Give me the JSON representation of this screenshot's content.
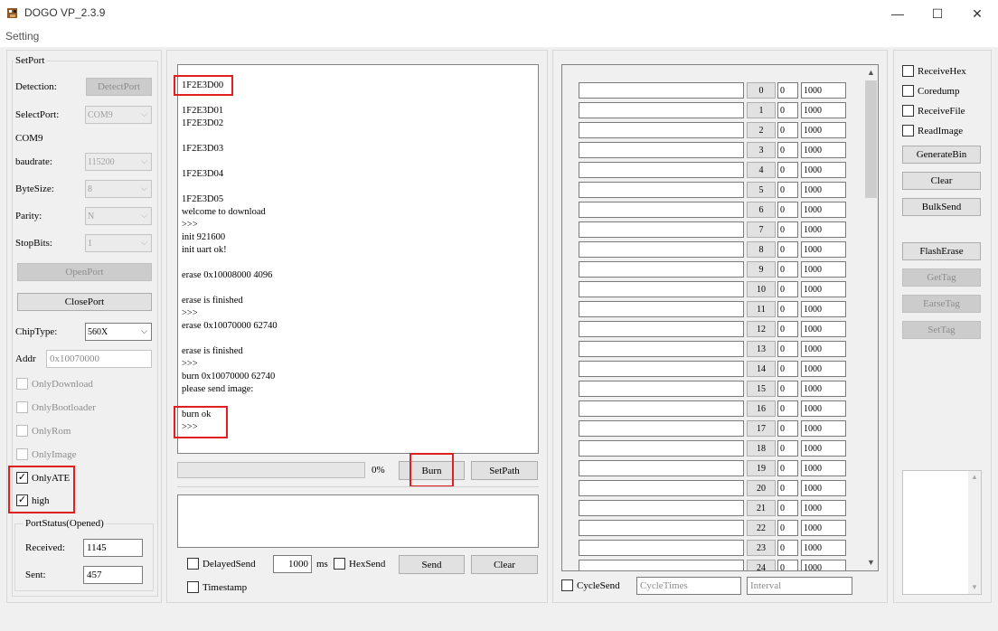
{
  "window": {
    "title": "DOGO  VP_2.3.9",
    "minimize_glyph": "—",
    "maximize_glyph": "☐",
    "close_glyph": "✕"
  },
  "menu": {
    "setting": "Setting"
  },
  "setport": {
    "title": "SetPort",
    "detection_label": "Detection:",
    "detect_button": "DetectPort",
    "selectport_label": "SelectPort:",
    "selectport_value": "COM9",
    "com_text": "COM9",
    "baudrate_label": "baudrate:",
    "baudrate_value": "115200",
    "bytesize_label": "ByteSize:",
    "bytesize_value": "8",
    "parity_label": "Parity:",
    "parity_value": "N",
    "stopbits_label": "StopBits:",
    "stopbits_value": "1",
    "openport_button": "OpenPort",
    "closeport_button": "ClosePort",
    "chiptype_label": "ChipType:",
    "chiptype_value": "560X",
    "addr_label": "Addr",
    "addr_value": "0x10070000",
    "only_download": "OnlyDownload",
    "only_bootloader": "OnlyBootloader",
    "only_rom": "OnlyRom",
    "only_image": "OnlyImage",
    "only_ate": "OnlyATE",
    "high": "high",
    "check_glyph": "✓"
  },
  "portstatus": {
    "title": "PortStatus(Opened)",
    "received_label": "Received:",
    "received_value": "1145",
    "sent_label": "Sent:",
    "sent_value": "457"
  },
  "log": {
    "lines": [
      "1F2E3D00",
      "1F2E3D01",
      "1F2E3D02",
      "1F2E3D03",
      "1F2E3D04",
      "1F2E3D05",
      "welcome to download",
      ">>>",
      "init 921600",
      "init uart ok!",
      "erase 0x10008000 4096",
      "erase is finished",
      ">>>",
      "erase 0x10070000 62740",
      "erase is finished",
      ">>>",
      "burn 0x10070000 62740",
      "please send image:",
      "burn ok",
      ">>>"
    ]
  },
  "burn": {
    "progress_text": "0%",
    "progress_value": 0,
    "burn_button": "Burn",
    "setpath_button": "SetPath"
  },
  "send": {
    "delayed_send": "DelayedSend",
    "delay_value": "1000",
    "ms_label": "ms",
    "hexsend": "HexSend",
    "send_button": "Send",
    "clear_button": "Clear",
    "timestamp": "Timestamp"
  },
  "multisend": {
    "rows": [
      {
        "num": "0",
        "a": "0",
        "b": "1000"
      },
      {
        "num": "1",
        "a": "0",
        "b": "1000"
      },
      {
        "num": "2",
        "a": "0",
        "b": "1000"
      },
      {
        "num": "3",
        "a": "0",
        "b": "1000"
      },
      {
        "num": "4",
        "a": "0",
        "b": "1000"
      },
      {
        "num": "5",
        "a": "0",
        "b": "1000"
      },
      {
        "num": "6",
        "a": "0",
        "b": "1000"
      },
      {
        "num": "7",
        "a": "0",
        "b": "1000"
      },
      {
        "num": "8",
        "a": "0",
        "b": "1000"
      },
      {
        "num": "9",
        "a": "0",
        "b": "1000"
      },
      {
        "num": "10",
        "a": "0",
        "b": "1000"
      },
      {
        "num": "11",
        "a": "0",
        "b": "1000"
      },
      {
        "num": "12",
        "a": "0",
        "b": "1000"
      },
      {
        "num": "13",
        "a": "0",
        "b": "1000"
      },
      {
        "num": "14",
        "a": "0",
        "b": "1000"
      },
      {
        "num": "15",
        "a": "0",
        "b": "1000"
      },
      {
        "num": "16",
        "a": "0",
        "b": "1000"
      },
      {
        "num": "17",
        "a": "0",
        "b": "1000"
      },
      {
        "num": "18",
        "a": "0",
        "b": "1000"
      },
      {
        "num": "19",
        "a": "0",
        "b": "1000"
      },
      {
        "num": "20",
        "a": "0",
        "b": "1000"
      },
      {
        "num": "21",
        "a": "0",
        "b": "1000"
      },
      {
        "num": "22",
        "a": "0",
        "b": "1000"
      },
      {
        "num": "23",
        "a": "0",
        "b": "1000"
      },
      {
        "num": "24",
        "a": "0",
        "b": "1000"
      }
    ],
    "cyclesend": "CycleSend",
    "cycletimes_placeholder": "CycleTimes",
    "interval_placeholder": "Interval",
    "scroll_up_glyph": "▲",
    "scroll_down_glyph": "▼"
  },
  "right": {
    "receive_hex": "ReceiveHex",
    "coredump": "Coredump",
    "receive_file": "ReceiveFile",
    "read_image": "ReadImage",
    "generate_bin": "GenerateBin",
    "clear": "Clear",
    "bulk_send": "BulkSend",
    "flash_erase": "FlashErase",
    "get_tag": "GetTag",
    "earse_tag": "EarseTag",
    "set_tag": "SetTag"
  }
}
